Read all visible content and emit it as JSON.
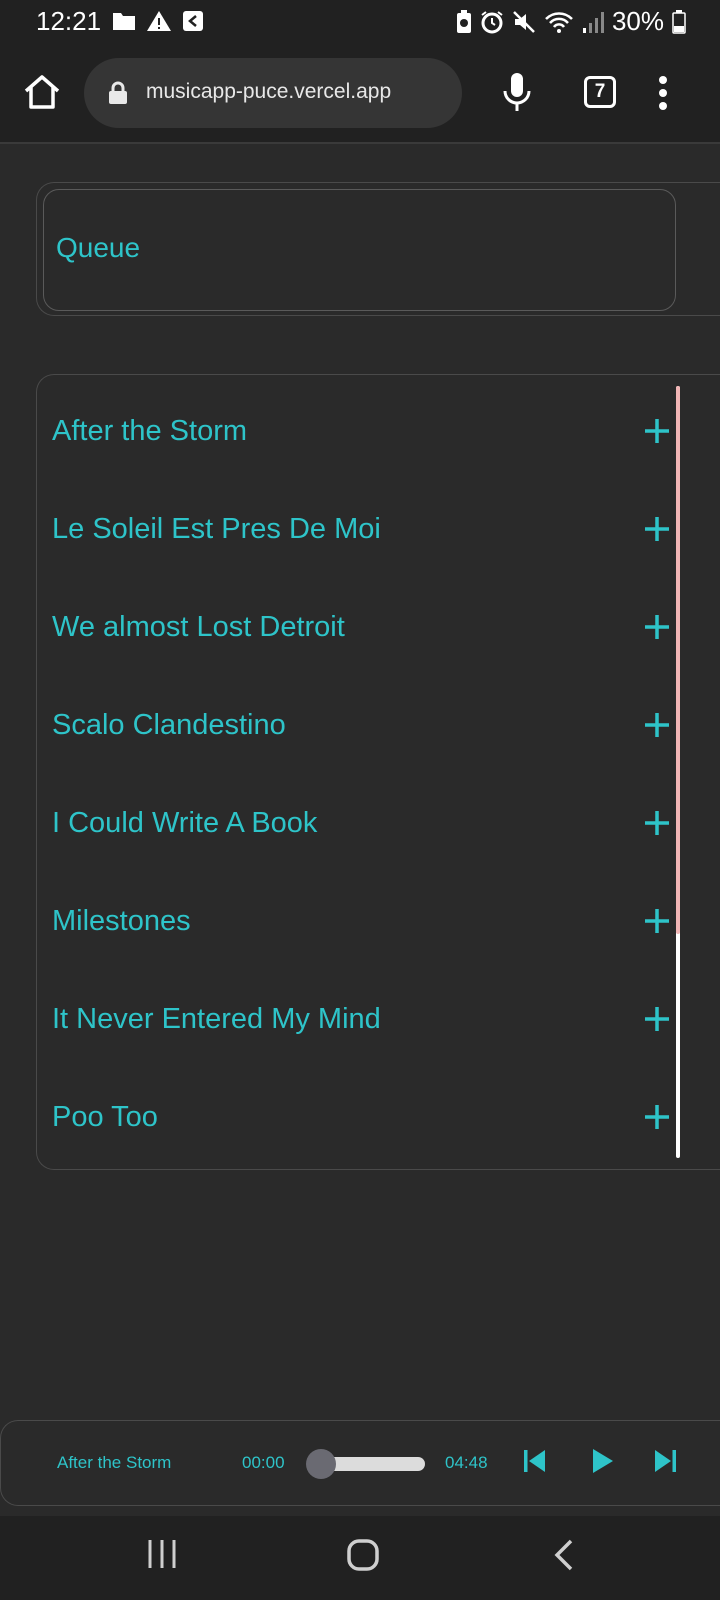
{
  "status": {
    "time": "12:21",
    "battery": "30%"
  },
  "browser": {
    "url": "musicapp-puce.vercel.app",
    "tab_count": "7"
  },
  "queue": {
    "title": "Queue"
  },
  "songs": [
    "After the Storm",
    "Le Soleil Est Pres De Moi",
    "We almost Lost Detroit",
    "Scalo Clandestino",
    "I Could Write A Book",
    "Milestones",
    "It Never Entered My Mind",
    "Poo Too"
  ],
  "player": {
    "title": "After the Storm",
    "current_time": "00:00",
    "duration": "04:48",
    "progress": 0
  },
  "colors": {
    "accent": "#2ec4c9",
    "background": "#2a2a2a",
    "chrome": "#212121"
  }
}
